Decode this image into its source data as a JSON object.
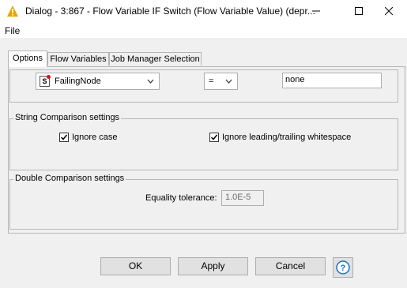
{
  "window": {
    "title": "Dialog - 3:867 - Flow Variable IF Switch (Flow Variable Value) (depr...",
    "icon": "warning-triangle-icon",
    "accent_color": "#e8a400"
  },
  "menu": {
    "file_label": "File"
  },
  "tabs": [
    {
      "label": "Options",
      "active": true
    },
    {
      "label": "Flow Variables",
      "active": false
    },
    {
      "label": "Job Manager Selection",
      "active": false
    }
  ],
  "condition": {
    "variable": "FailingNode",
    "variable_icon_letter": "S",
    "operator": "=",
    "value": "none"
  },
  "string_settings": {
    "title": "String Comparison settings",
    "ignore_case_label": "Ignore case",
    "ignore_case_checked": true,
    "ignore_whitespace_label": "Ignore leading/trailing whitespace",
    "ignore_whitespace_checked": true
  },
  "double_settings": {
    "title": "Double Comparison settings",
    "tolerance_label": "Equality tolerance:",
    "tolerance_value": "1.0E-5"
  },
  "buttons": {
    "ok": "OK",
    "apply": "Apply",
    "cancel": "Cancel",
    "help_icon": "help-icon"
  }
}
